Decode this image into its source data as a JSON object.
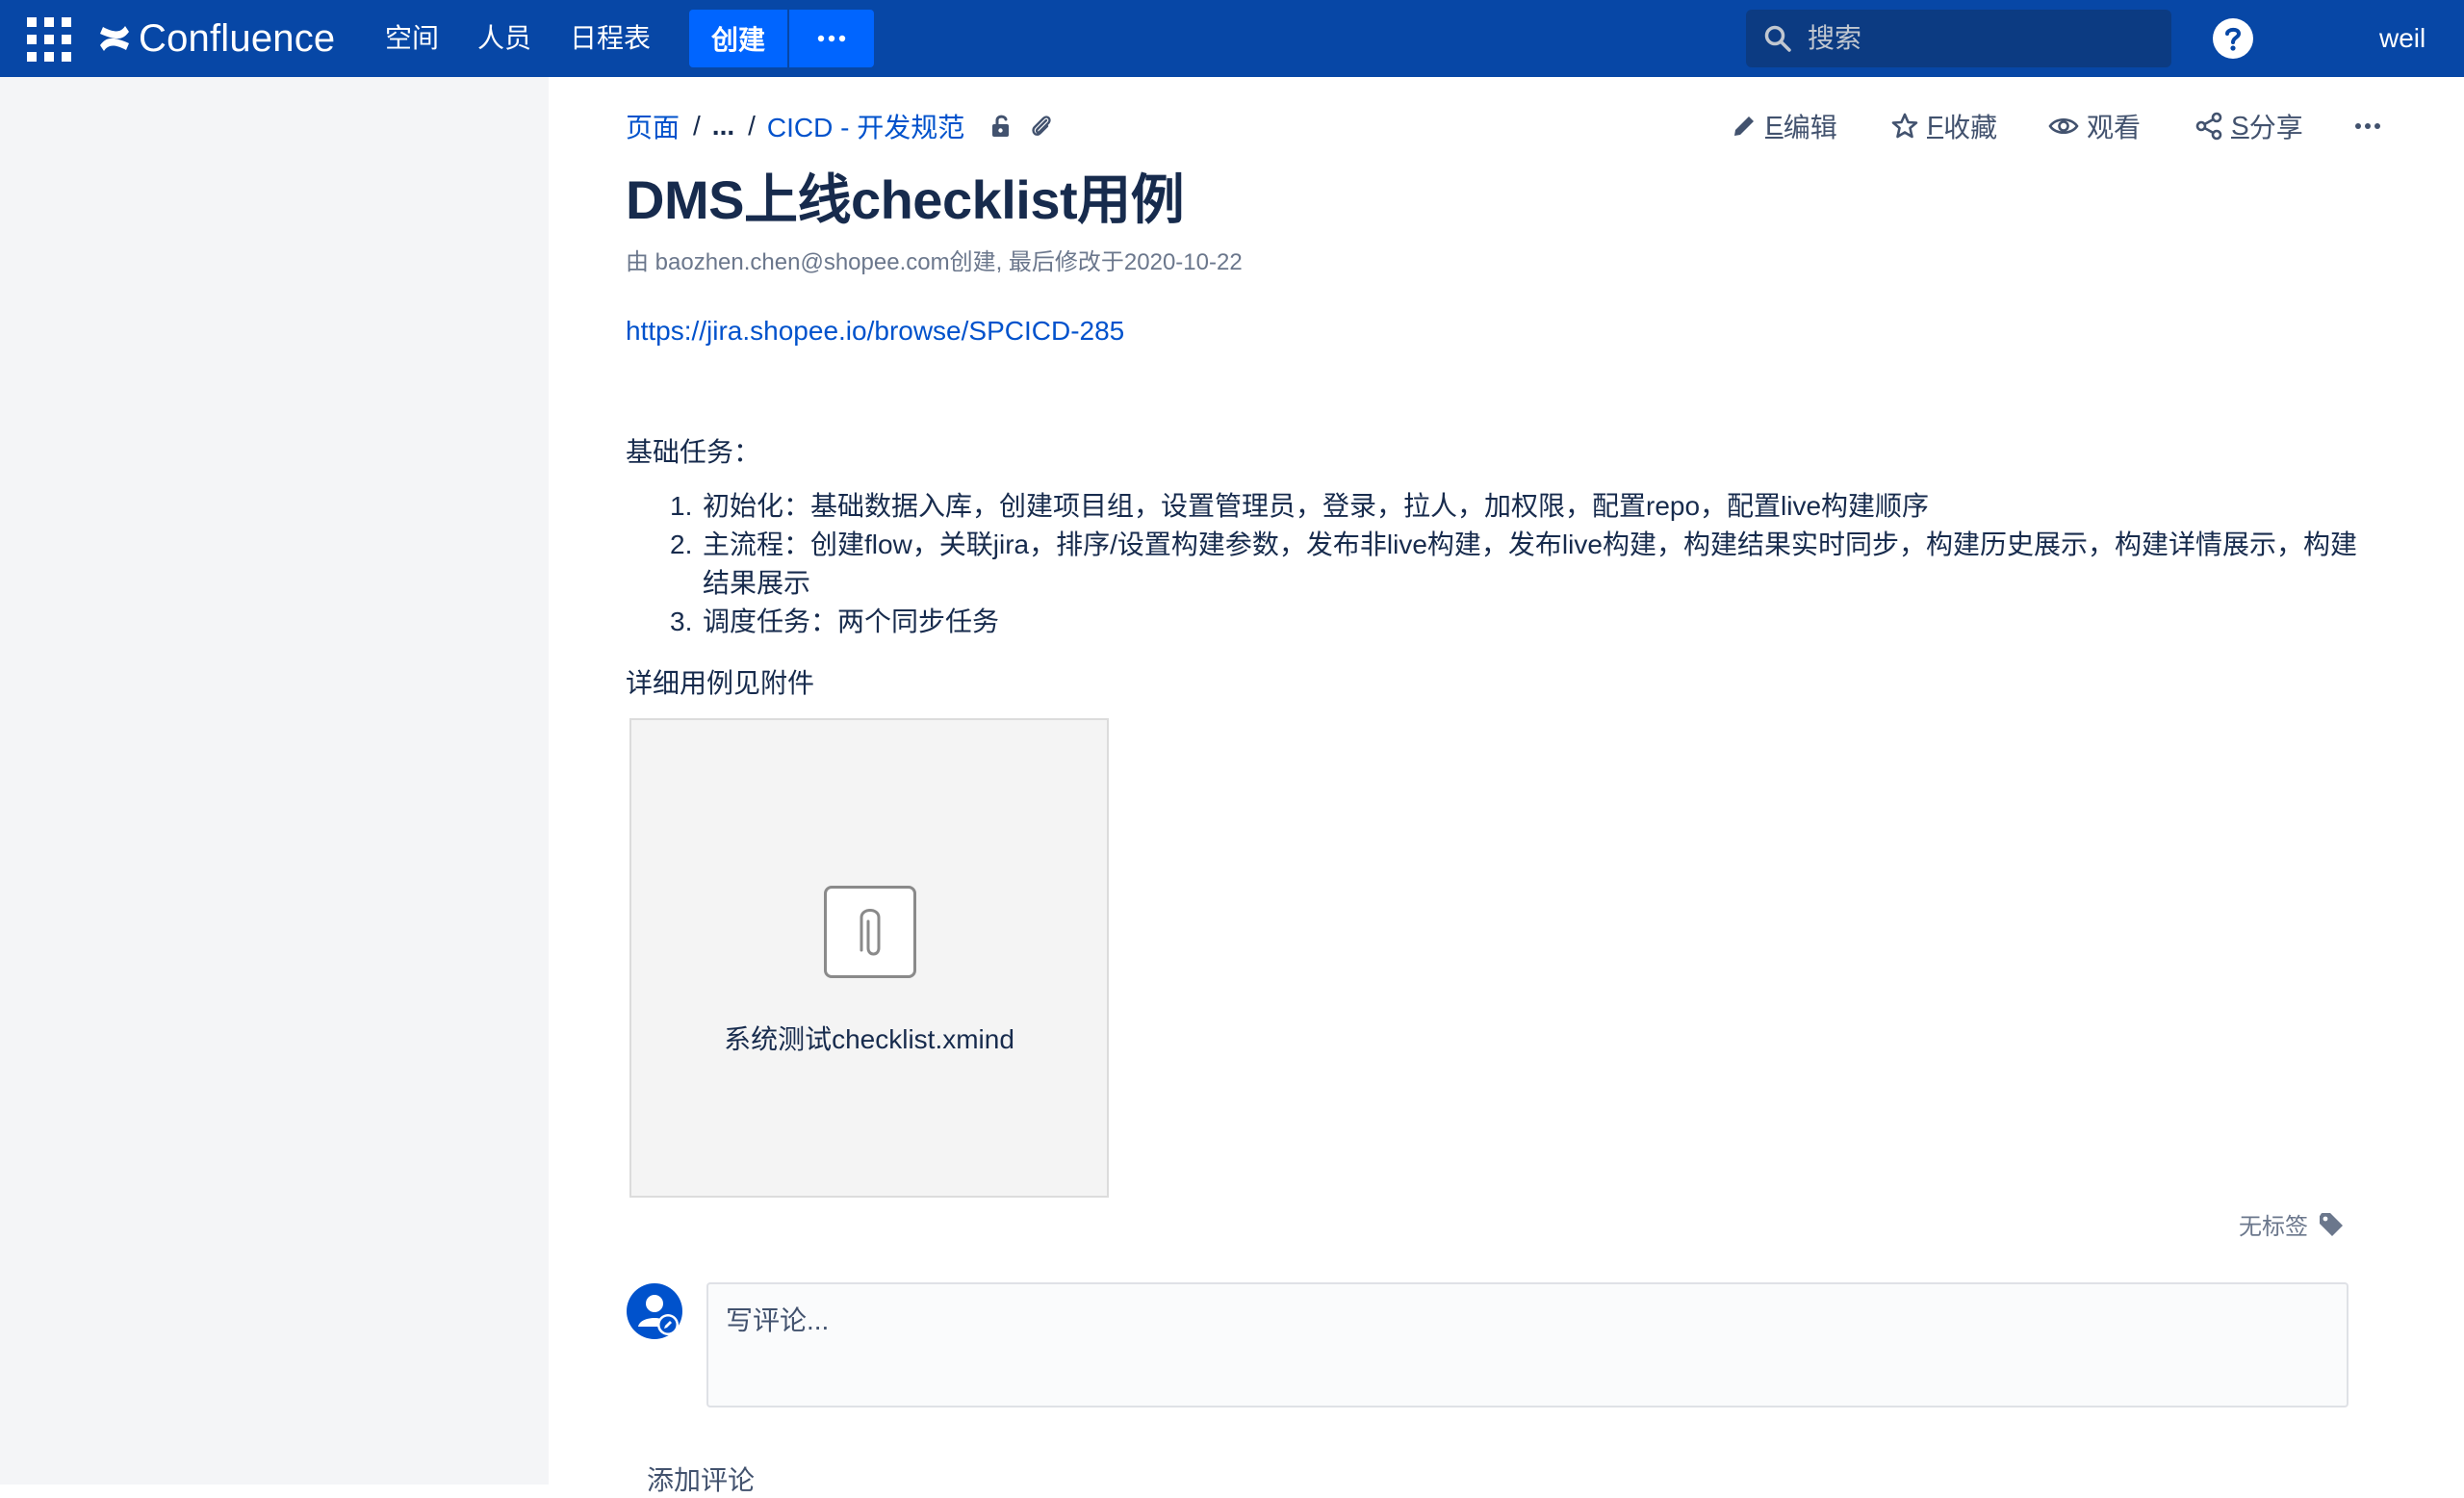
{
  "topbar": {
    "app_name": "Confluence",
    "nav": [
      "空间",
      "人员",
      "日程表"
    ],
    "create_label": "创建",
    "more_label": "···",
    "search_placeholder": "搜索",
    "user_name": "weil"
  },
  "breadcrumb": {
    "root": "页面",
    "ellipsis": "...",
    "parent": "CICD - 开发规范"
  },
  "actions": {
    "edit": {
      "key": "E",
      "label": "编辑"
    },
    "favorite": {
      "key": "F",
      "label": "收藏"
    },
    "watch": {
      "label": "观看"
    },
    "share": {
      "key": "S",
      "label": "分享"
    },
    "more": "···"
  },
  "page": {
    "title": "DMS上线checklist用例",
    "byline": "由 baozhen.chen@shopee.com创建, 最后修改于2020-10-22",
    "link": "https://jira.shopee.io/browse/SPCICD-285",
    "basic_tasks_heading": "基础任务：",
    "tasks": [
      {
        "num": "1.",
        "text": "初始化：基础数据入库，创建项目组，设置管理员，登录，拉人，加权限，配置repo，配置live构建顺序"
      },
      {
        "num": "2.",
        "text": "主流程：创建flow，关联jira，排序/设置构建参数，发布非live构建，发布live构建，构建结果实时同步，构建历史展示，构建详情展示，构建结果展示"
      },
      {
        "num": "3.",
        "text": "调度任务：两个同步任务"
      }
    ],
    "detail_heading": "详细用例见附件",
    "attachment_name": "系统测试checklist.xmind",
    "no_labels": "无标签"
  },
  "comments": {
    "placeholder": "写评论...",
    "add_comment": "添加评论"
  },
  "colors": {
    "topbar": "#0747a6",
    "create_button": "#0065ff",
    "link": "#0052cc",
    "sidebar": "#f4f5f7"
  },
  "icons": [
    "app-switcher-icon",
    "confluence-logo-icon",
    "search-icon",
    "help-icon",
    "unlock-icon",
    "paperclip-icon",
    "pencil-icon",
    "star-icon",
    "eye-icon",
    "share-icon",
    "ellipsis-icon",
    "tag-icon",
    "avatar-icon"
  ]
}
